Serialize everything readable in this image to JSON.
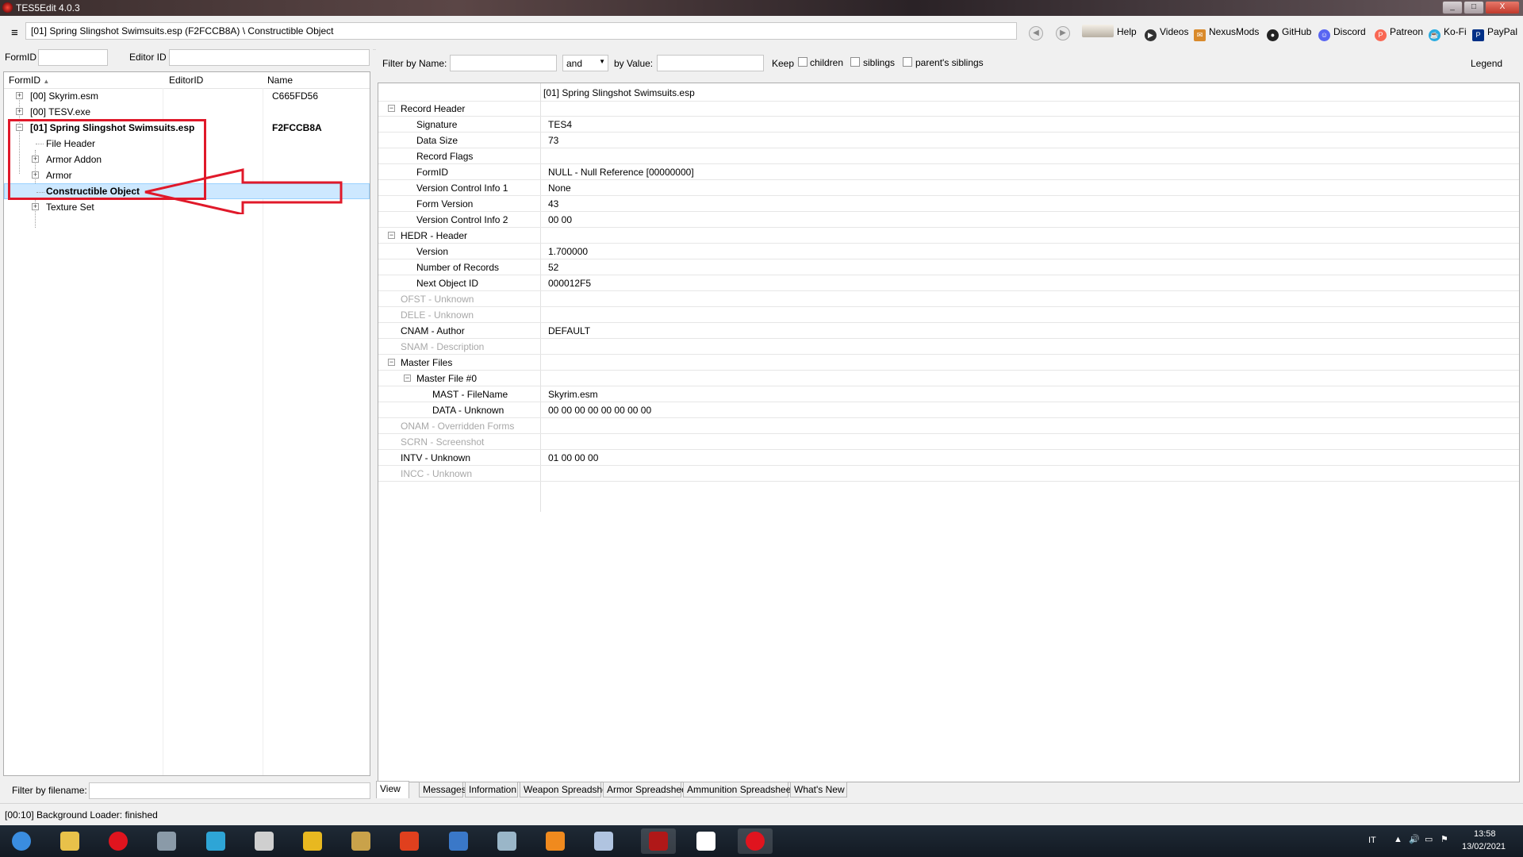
{
  "window": {
    "title": "TES5Edit 4.0.3",
    "controls": [
      "_",
      "□",
      "X"
    ]
  },
  "toolbar": {
    "menu_glyph": "≡",
    "path": "[01] Spring Slingshot Swimsuits.esp (F2FCCB8A) \\ Constructible Object",
    "links": [
      {
        "label": "Help",
        "icon": "book-icon"
      },
      {
        "label": "Videos",
        "icon": "videos-icon"
      },
      {
        "label": "NexusMods",
        "icon": "nexusmods-icon"
      },
      {
        "label": "GitHub",
        "icon": "github-icon"
      },
      {
        "label": "Discord",
        "icon": "discord-icon"
      },
      {
        "label": "Patreon",
        "icon": "patreon-icon"
      },
      {
        "label": "Ko-Fi",
        "icon": "kofi-icon"
      },
      {
        "label": "PayPal",
        "icon": "paypal-icon"
      }
    ]
  },
  "left": {
    "formid_label": "FormID",
    "editorid_label": "Editor ID",
    "columns": [
      "FormID",
      "EditorID",
      "Name"
    ],
    "sort_glyph": "▲",
    "tree": [
      {
        "text": "[00] Skyrim.esm",
        "name": "C665FD56",
        "level": 0,
        "expander": "+",
        "bold": false
      },
      {
        "text": "[00] TESV.exe",
        "name": "",
        "level": 0,
        "expander": "+",
        "bold": false
      },
      {
        "text": "[01] Spring Slingshot Swimsuits.esp",
        "name": "F2FCCB8A",
        "level": 0,
        "expander": "−",
        "bold": true
      },
      {
        "text": "File Header",
        "name": "",
        "level": 1,
        "expander": "",
        "bold": false
      },
      {
        "text": "Armor Addon",
        "name": "",
        "level": 1,
        "expander": "+",
        "bold": false
      },
      {
        "text": "Armor",
        "name": "",
        "level": 1,
        "expander": "+",
        "bold": false
      },
      {
        "text": "Constructible Object",
        "name": "",
        "level": 1,
        "expander": "",
        "bold": true,
        "selected": true
      },
      {
        "text": "Texture Set",
        "name": "",
        "level": 1,
        "expander": "+",
        "bold": false
      }
    ],
    "filter_label": "Filter by filename:"
  },
  "right": {
    "filter": {
      "by_name": "Filter by Name:",
      "op": "and",
      "by_value": "by Value:",
      "keep": "Keep",
      "children": "children",
      "siblings": "siblings",
      "parents_siblings": "parent's siblings",
      "legend": "Legend"
    },
    "header": "[01] Spring Slingshot Swimsuits.esp",
    "rows": [
      {
        "n": "Record Header",
        "v": "",
        "lvl": 0,
        "exp": "−",
        "dim": false
      },
      {
        "n": "Signature",
        "v": "TES4",
        "lvl": 1,
        "exp": "",
        "dim": false
      },
      {
        "n": "Data Size",
        "v": "73",
        "lvl": 1,
        "exp": "",
        "dim": false
      },
      {
        "n": "Record Flags",
        "v": "",
        "lvl": 1,
        "exp": "",
        "dim": false
      },
      {
        "n": "FormID",
        "v": "NULL - Null Reference [00000000]",
        "lvl": 1,
        "exp": "",
        "dim": false
      },
      {
        "n": "Version Control Info 1",
        "v": "None",
        "lvl": 1,
        "exp": "",
        "dim": false
      },
      {
        "n": "Form Version",
        "v": "43",
        "lvl": 1,
        "exp": "",
        "dim": false
      },
      {
        "n": "Version Control Info 2",
        "v": "00 00",
        "lvl": 1,
        "exp": "",
        "dim": false
      },
      {
        "n": "HEDR - Header",
        "v": "",
        "lvl": 0,
        "exp": "−",
        "dim": false
      },
      {
        "n": "Version",
        "v": "1.700000",
        "lvl": 1,
        "exp": "",
        "dim": false
      },
      {
        "n": "Number of Records",
        "v": "52",
        "lvl": 1,
        "exp": "",
        "dim": false
      },
      {
        "n": "Next Object ID",
        "v": "000012F5",
        "lvl": 1,
        "exp": "",
        "dim": false
      },
      {
        "n": "OFST - Unknown",
        "v": "",
        "lvl": 0,
        "exp": "",
        "dim": true
      },
      {
        "n": "DELE - Unknown",
        "v": "",
        "lvl": 0,
        "exp": "",
        "dim": true
      },
      {
        "n": "CNAM - Author",
        "v": "DEFAULT",
        "lvl": 0,
        "exp": "",
        "dim": false
      },
      {
        "n": "SNAM - Description",
        "v": "",
        "lvl": 0,
        "exp": "",
        "dim": true
      },
      {
        "n": "Master Files",
        "v": "",
        "lvl": 0,
        "exp": "−",
        "dim": false
      },
      {
        "n": "Master File #0",
        "v": "",
        "lvl": 1,
        "exp": "−",
        "dim": false
      },
      {
        "n": "MAST - FileName",
        "v": "Skyrim.esm",
        "lvl": 2,
        "exp": "",
        "dim": false
      },
      {
        "n": "DATA - Unknown",
        "v": "00 00 00 00 00 00 00 00",
        "lvl": 2,
        "exp": "",
        "dim": false
      },
      {
        "n": "ONAM - Overridden Forms",
        "v": "",
        "lvl": 0,
        "exp": "",
        "dim": true
      },
      {
        "n": "SCRN - Screenshot",
        "v": "",
        "lvl": 0,
        "exp": "",
        "dim": true
      },
      {
        "n": "INTV - Unknown",
        "v": "01 00 00 00",
        "lvl": 0,
        "exp": "",
        "dim": false
      },
      {
        "n": "INCC - Unknown",
        "v": "",
        "lvl": 0,
        "exp": "",
        "dim": true
      }
    ],
    "tabs": [
      "View",
      "Messages",
      "Information",
      "Weapon Spreadsheet",
      "Armor Spreadsheet",
      "Ammunition Spreadsheet",
      "What's New"
    ],
    "active_tab": 0
  },
  "status": "[00:10] Background Loader: finished",
  "taskbar": {
    "apps": [
      {
        "icon": "windows-start-icon",
        "color": "#3a8de0"
      },
      {
        "icon": "folder-icon",
        "color": "#e8c14a"
      },
      {
        "icon": "opera-icon",
        "color": "#e0141e"
      },
      {
        "icon": "film-icon",
        "color": "#8a9aa8"
      },
      {
        "icon": "music-icon",
        "color": "#2ea5d6"
      },
      {
        "icon": "speaker-app-icon",
        "color": "#cfcfcf"
      },
      {
        "icon": "game-icon",
        "color": "#e8b820"
      },
      {
        "icon": "horse-icon",
        "color": "#c9a24a"
      },
      {
        "icon": "f-app-icon",
        "color": "#e0401e"
      },
      {
        "icon": "ffdec-icon",
        "color": "#3a78c8"
      },
      {
        "icon": "window-icon",
        "color": "#9ab6c8"
      },
      {
        "icon": "cross-app-icon",
        "color": "#f08a1e"
      },
      {
        "icon": "feather-icon",
        "color": "#b0c4e0"
      },
      {
        "icon": "tes5edit-icon",
        "color": "#b01818"
      },
      {
        "icon": "people-icon",
        "color": "#ffffff"
      },
      {
        "icon": "opera-red-icon",
        "color": "#e0141e"
      }
    ],
    "lang": "IT",
    "time": "13:58",
    "date": "13/02/2021"
  }
}
